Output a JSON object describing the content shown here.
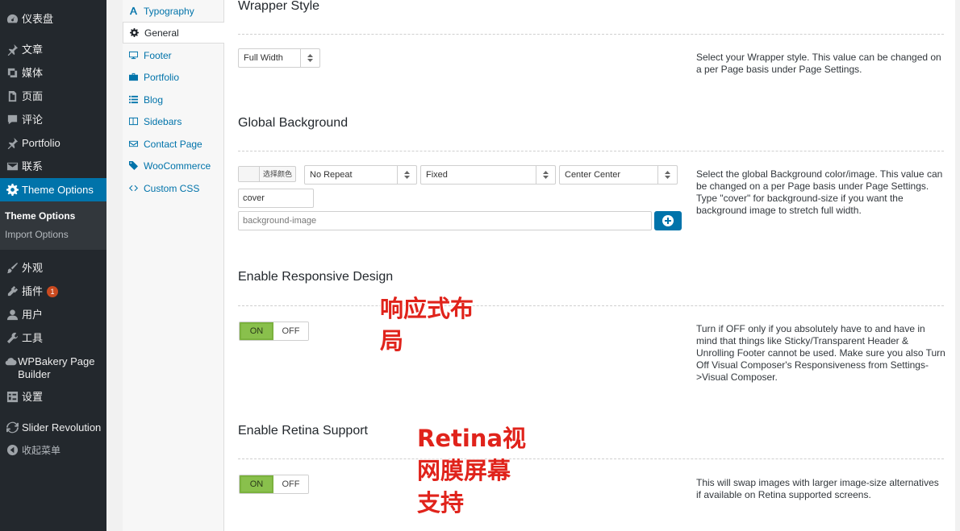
{
  "admin_menu": {
    "items": [
      {
        "label": "仪表盘",
        "icon": "dashboard-icon"
      },
      {
        "label": "文章",
        "icon": "pin-icon"
      },
      {
        "label": "媒体",
        "icon": "media-icon"
      },
      {
        "label": "页面",
        "icon": "page-icon"
      },
      {
        "label": "评论",
        "icon": "comment-icon"
      },
      {
        "label": "Portfolio",
        "icon": "pin-icon"
      },
      {
        "label": "联系",
        "icon": "mail-icon"
      },
      {
        "label": "Theme Options",
        "icon": "gear-icon"
      },
      {
        "label": "外观",
        "icon": "brush-icon"
      },
      {
        "label": "插件",
        "icon": "plugin-icon",
        "badge": "1"
      },
      {
        "label": "用户",
        "icon": "user-icon"
      },
      {
        "label": "工具",
        "icon": "wrench-icon"
      },
      {
        "label": "WPBakery Page Builder",
        "icon": "cloud-icon"
      },
      {
        "label": "设置",
        "icon": "settings-icon"
      },
      {
        "label": "Slider Revolution",
        "icon": "refresh-icon"
      },
      {
        "label": "收起菜单",
        "icon": "collapse-icon"
      }
    ],
    "submenu": [
      {
        "label": "Theme Options"
      },
      {
        "label": "Import Options"
      }
    ]
  },
  "options_nav": {
    "tabs": [
      {
        "label": "Typography",
        "icon": "typography-icon"
      },
      {
        "label": "General",
        "icon": "gear-icon"
      },
      {
        "label": "Footer",
        "icon": "monitor-icon"
      },
      {
        "label": "Portfolio",
        "icon": "briefcase-icon"
      },
      {
        "label": "Blog",
        "icon": "list-icon"
      },
      {
        "label": "Sidebars",
        "icon": "columns-icon"
      },
      {
        "label": "Contact Page",
        "icon": "envelope-icon"
      },
      {
        "label": "WooCommerce",
        "icon": "tag-icon"
      },
      {
        "label": "Custom CSS",
        "icon": "code-icon"
      }
    ]
  },
  "sections": {
    "wrapper": {
      "title": "Wrapper Style",
      "select_value": "Full Width",
      "desc": "Select your Wrapper style. This value can be changed on a per Page basis under Page Settings."
    },
    "background": {
      "title": "Global Background",
      "color_label": "选择颜色",
      "repeat": "No Repeat",
      "attachment": "Fixed",
      "position": "Center Center",
      "size_value": "cover",
      "image_placeholder": "background-image",
      "desc": "Select the global Background color/image. This value can be changed on a per Page basis under Page Settings. Type \"cover\" for background-size if you want the background image to stretch full width."
    },
    "responsive": {
      "title": "Enable Responsive Design",
      "on_label": "ON",
      "off_label": "OFF",
      "desc": "Turn if OFF only if you absolutely have to and have in mind that things like Sticky/Transparent Header & Unrolling Footer cannot be used. Make sure you also Turn Off Visual Composer's Responsiveness from Settings->Visual Composer.",
      "annotation_line1": "响应式布",
      "annotation_line2": "局"
    },
    "retina": {
      "title": "Enable Retina Support",
      "on_label": "ON",
      "off_label": "OFF",
      "desc": "This will swap images with larger image-size alternatives if available on Retina supported screens.",
      "annotation_line1": "Retina视",
      "annotation_line2": "网膜屏幕",
      "annotation_line3": "支持"
    }
  }
}
